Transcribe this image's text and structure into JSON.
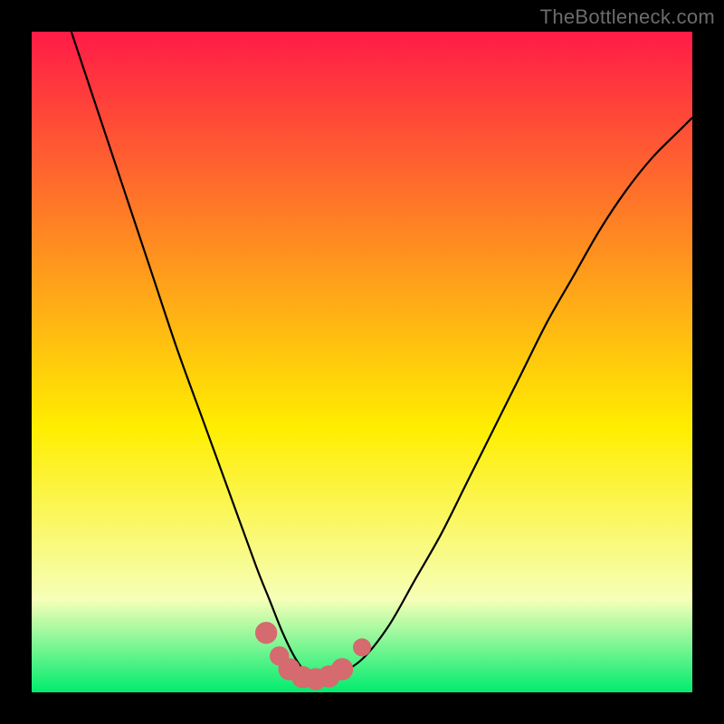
{
  "watermark": "TheBottleneck.com",
  "colors": {
    "bg": "#000000",
    "gradient_top": "#ff1b47",
    "gradient_yellow": "#ffee00",
    "gradient_pale": "#f6ffb8",
    "gradient_green": "#00ec6e",
    "curve": "#000000",
    "marker_fill": "#d56a6f",
    "marker_stroke": "#d56a6f"
  },
  "chart_data": {
    "type": "line",
    "title": "",
    "xlabel": "",
    "ylabel": "",
    "xlim": [
      0,
      100
    ],
    "ylim": [
      0,
      100
    ],
    "series": [
      {
        "name": "bottleneck-curve",
        "x": [
          6,
          10,
          14,
          18,
          22,
          26,
          30,
          34,
          36,
          38,
          40,
          42,
          44,
          46,
          50,
          54,
          58,
          62,
          66,
          70,
          74,
          78,
          82,
          86,
          90,
          94,
          98,
          100
        ],
        "y": [
          100,
          88,
          76,
          64,
          52,
          41,
          30,
          19,
          14,
          9,
          5,
          2.5,
          2,
          2.5,
          5,
          10,
          17,
          24,
          32,
          40,
          48,
          56,
          63,
          70,
          76,
          81,
          85,
          87
        ]
      }
    ],
    "markers": [
      {
        "x": 35.5,
        "y": 9.0,
        "r": 1.6
      },
      {
        "x": 37.5,
        "y": 5.5,
        "r": 1.4
      },
      {
        "x": 39.0,
        "y": 3.5,
        "r": 1.6
      },
      {
        "x": 41.0,
        "y": 2.3,
        "r": 1.6
      },
      {
        "x": 43.0,
        "y": 2.0,
        "r": 1.6
      },
      {
        "x": 45.0,
        "y": 2.4,
        "r": 1.6
      },
      {
        "x": 47.0,
        "y": 3.5,
        "r": 1.6
      },
      {
        "x": 50.0,
        "y": 6.8,
        "r": 1.3
      }
    ]
  }
}
